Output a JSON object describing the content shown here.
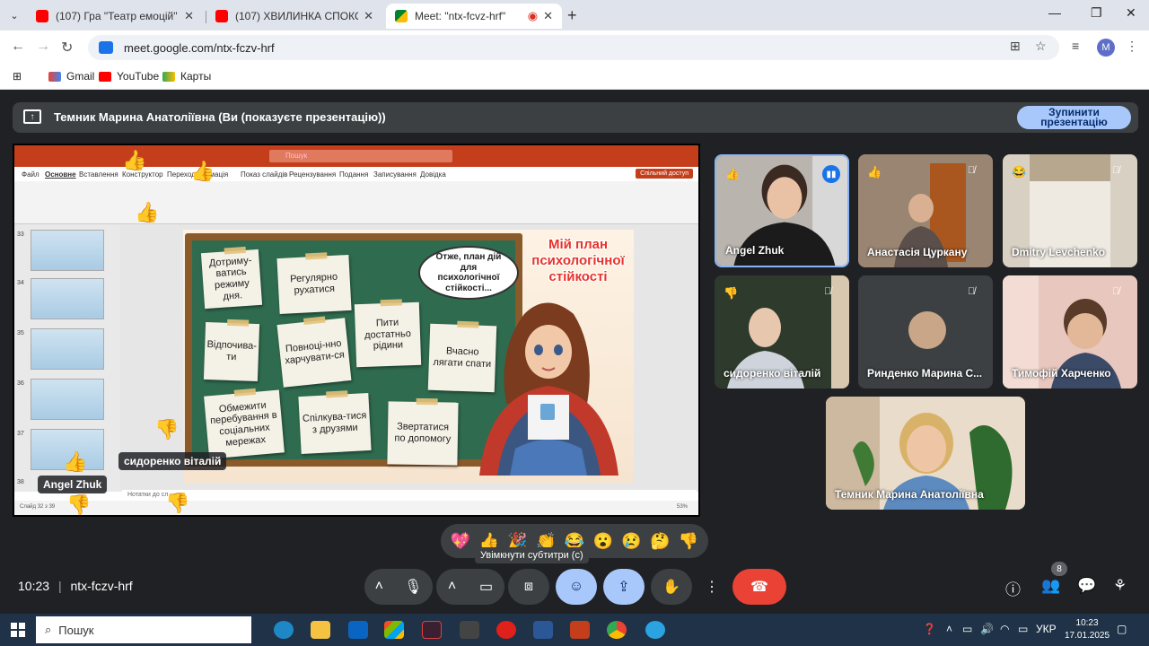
{
  "browser": {
    "tabs": [
      {
        "title": "(107) Гра \"Театр емоцій\" - You",
        "active": false
      },
      {
        "title": "(107) ХВИЛИНКА СПОКОЮ - Y",
        "active": false
      },
      {
        "title": "Meet: \"ntx-fcvz-hrf\"",
        "active": true
      }
    ],
    "address": "meet.google.com/ntx-fczv-hrf",
    "profile_initial": "M",
    "bookmarks": [
      "Gmail",
      "YouTube",
      "Карты"
    ]
  },
  "meet": {
    "presenting_banner": "Темник Марина Анатоліївна (Ви (показуєте презентацію))",
    "stop_button": "Зупинити презентацію",
    "meeting_code": "ntx-fczv-hrf",
    "time": "10:23",
    "participants_count": "8",
    "caption_tooltip": "Увімкнути субтитри (c)",
    "reactions": [
      "💖",
      "👍",
      "🎉",
      "👏",
      "😂",
      "😮",
      "😢",
      "🤔",
      "👎"
    ],
    "overlay_names": {
      "sydorenko": "сидоренко віталій",
      "angel": "Angel Zhuk"
    }
  },
  "slide": {
    "title": "Мій план психологічної стійкості",
    "bubble": "Отже, план дій для психологічної стійкості...",
    "notes": [
      "Дотриму-ватись режиму дня.",
      "Регулярно рухатися",
      "Відпочива-ти",
      "Повноці-нно харчувати-ся",
      "Пити достатньо рідини",
      "Вчасно лягати спати",
      "Обмежити перебування в соціальних мережах",
      "Спілкува-тися з друзями",
      "Звертатися по допомогу"
    ]
  },
  "powerpoint": {
    "search": "Пошук",
    "share": "Спільний доступ",
    "menu": [
      "Файл",
      "Основне",
      "Вставлення",
      "Конструктор",
      "Переходи",
      "Анімація",
      "Показ слайдів",
      "Рецензування",
      "Подання",
      "Записування",
      "Довідка"
    ],
    "thumb_numbers": [
      "33",
      "34",
      "35",
      "36",
      "37",
      "38"
    ],
    "notes_placeholder": "Нотатки до сл",
    "status": "Слайд 32 з 39",
    "zoom": "53%"
  },
  "participants": [
    {
      "name": "Angel Zhuk",
      "reaction": "👍",
      "muted": false,
      "speaking": true
    },
    {
      "name": "Анастасія Цуркану",
      "reaction": "👍",
      "muted": true,
      "speaking": false
    },
    {
      "name": "Dmitry Levchenko",
      "reaction": "😂",
      "muted": true,
      "speaking": false
    },
    {
      "name": "сидоренко віталій",
      "reaction": "👎",
      "muted": true,
      "speaking": false
    },
    {
      "name": "Ринденко Марина С...",
      "reaction": "",
      "muted": true,
      "speaking": false
    },
    {
      "name": "Тимофій Харченко",
      "reaction": "",
      "muted": true,
      "speaking": false
    },
    {
      "name": "Темник Марина Анатоліївна",
      "reaction": "",
      "muted": false,
      "speaking": false
    }
  ],
  "taskbar": {
    "search": "Пошук",
    "lang": "УКР",
    "time": "10:23",
    "date": "17.01.2025"
  },
  "colors": {
    "meet_bg": "#202124",
    "tile_bg": "#3c4043",
    "accent_blue": "#a8c7fa",
    "end_call_red": "#ea4335",
    "pp_red": "#c43e1c"
  }
}
